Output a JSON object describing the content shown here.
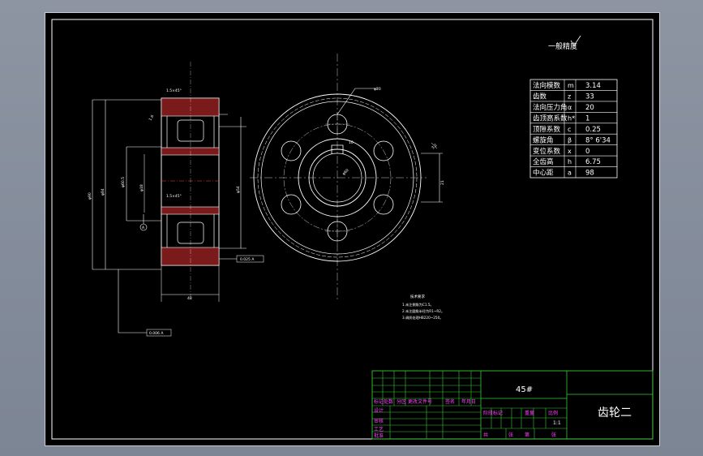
{
  "surface_note": "一般精度",
  "gear_table": {
    "rows": [
      {
        "name": "法向模数",
        "symbol": "m",
        "value": "3.14"
      },
      {
        "name": "齿数",
        "symbol": "z",
        "value": "33"
      },
      {
        "name": "法向压力角",
        "symbol": "α",
        "value": "20"
      },
      {
        "name": "齿顶高系数",
        "symbol": "h*",
        "value": "1"
      },
      {
        "name": "顶隙系数",
        "symbol": "c",
        "value": "0.25"
      },
      {
        "name": "螺旋角",
        "symbol": "β",
        "value": "8° 6'34"
      },
      {
        "name": "变位系数",
        "symbol": "x",
        "value": "0"
      },
      {
        "name": "全齿高",
        "symbol": "h",
        "value": "6.75"
      },
      {
        "name": "中心距",
        "symbol": "a",
        "value": "98"
      }
    ]
  },
  "tech_req": {
    "title": "技术要求",
    "items": [
      "1.未注倒角为C1.5。",
      "2.未注圆角半径为R1~R2。",
      "3.调质处理HB220~250。"
    ]
  },
  "title_block": {
    "material": "45#",
    "part_name": "齿轮二",
    "scale": "1:1",
    "rev_headers": [
      "标记",
      "处数",
      "分区",
      "更改文件号",
      "签名",
      "年月日"
    ],
    "stage_headers": [
      "阶段标记",
      "重量",
      "比例"
    ],
    "left_labels": [
      "设计",
      "审核",
      "工艺",
      "批准"
    ],
    "bottom_labels": [
      "共",
      "张",
      "第",
      "张"
    ]
  },
  "dimensions": {
    "section": [
      "1.5×45°",
      "1.5×45°",
      "1.6",
      "φ60.5",
      "φ90",
      "φ18",
      "φ54",
      "φ84",
      "0.025 A",
      "A",
      "48",
      "0.006 A"
    ],
    "front": [
      "φ20",
      "φ60",
      "21",
      "10",
      "3.2"
    ]
  }
}
